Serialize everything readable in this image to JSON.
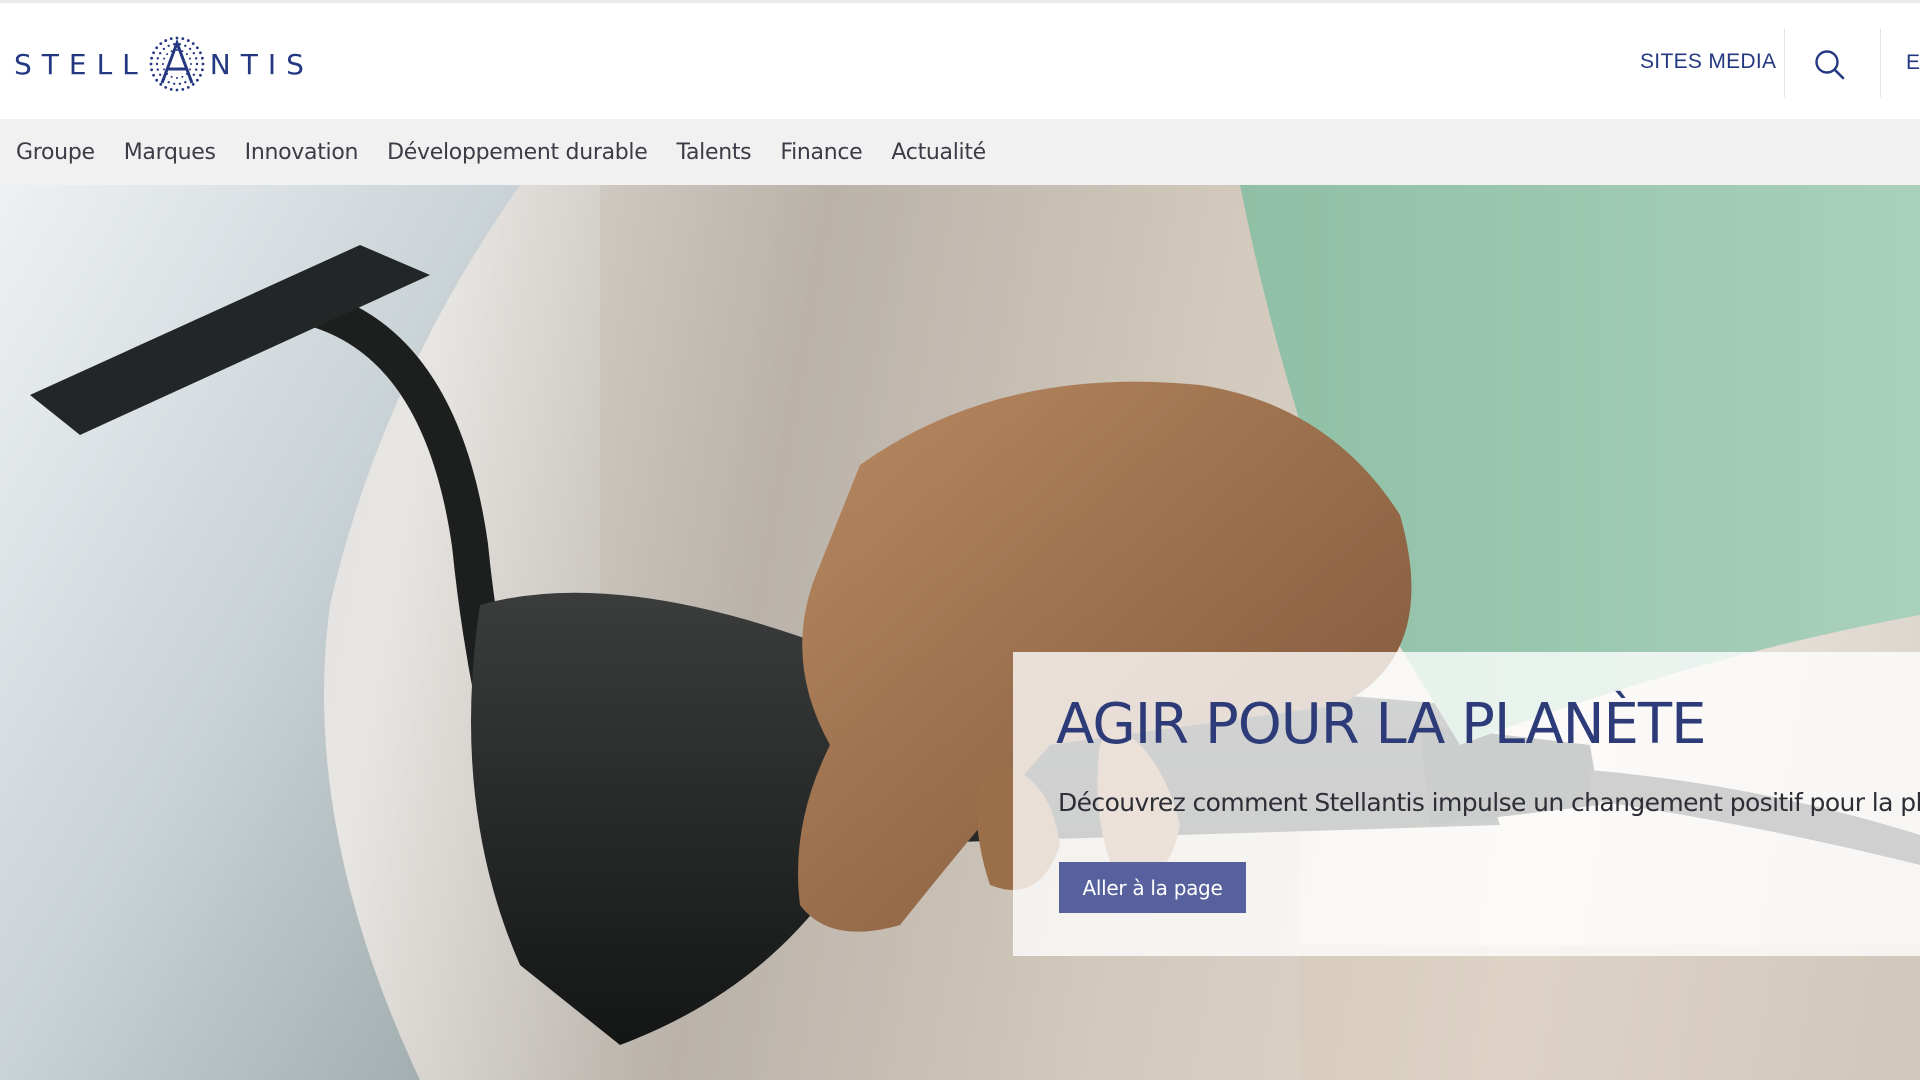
{
  "brand": {
    "logo_text_left": "STELL",
    "logo_text_right": "NTIS",
    "logo_alt": "STELLANTIS"
  },
  "header": {
    "sites_media": "SITES MEDIA",
    "language_label": "E"
  },
  "nav": {
    "items": [
      {
        "label": "Groupe"
      },
      {
        "label": "Marques"
      },
      {
        "label": "Innovation"
      },
      {
        "label": "Développement durable"
      },
      {
        "label": "Talents"
      },
      {
        "label": "Finance"
      },
      {
        "label": "Actualité"
      }
    ]
  },
  "hero": {
    "title": "AGIR POUR LA PLANÈTE",
    "description": "Découvrez comment Stellantis impulse un changement positif pour la planète",
    "button_label": "Aller à la page"
  },
  "icons": {
    "search": "search-icon",
    "logo_mark": "stellantis-star-mark-icon"
  },
  "colors": {
    "brand_blue": "#243882",
    "button": "#56619e",
    "nav_bg": "#f1f1f2"
  }
}
